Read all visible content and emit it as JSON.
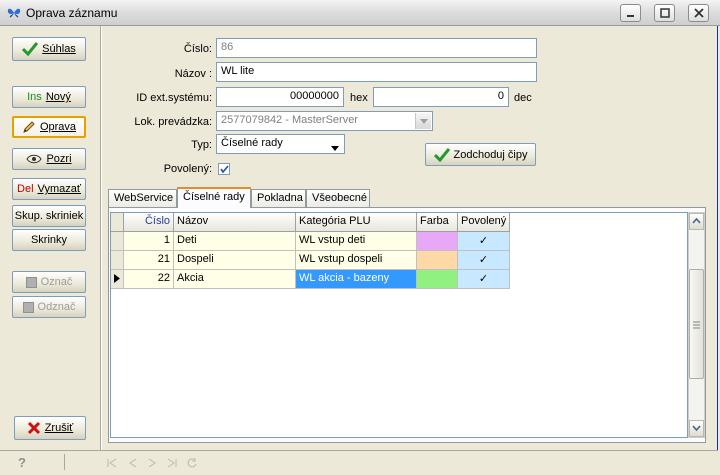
{
  "window": {
    "title": "Oprava záznamu"
  },
  "left_buttons": {
    "suhlas": "Súhlas",
    "novy_prefix": "Ins",
    "novy": "Nový",
    "oprava": "Oprava",
    "pozri": "Pozri",
    "vymazat_prefix": "Del",
    "vymazat": "Vymazať",
    "skup_skriniek": "Skup. skriniek",
    "skrinky": "Skrinky",
    "oznac": "Označ",
    "odznac": "Odznač",
    "zrusit": "Zrušiť"
  },
  "form": {
    "cislo_label": "Číslo:",
    "cislo_value": "86",
    "nazov_label": "Názov :",
    "nazov_value": "WL lite",
    "id_label": "ID ext.systému:",
    "id_hex_value": "00000000",
    "hex_label": "hex",
    "id_dec_value": "0",
    "dec_label": "dec",
    "prevadzka_label": "Lok. prevádzka:",
    "prevadzka_value": "2577079842 - MasterServer",
    "typ_label": "Typ:",
    "typ_value": "Číselné rady",
    "povoleny_label": "Povolený:",
    "povoleny_checked": true,
    "zodchoduj_button": "Zodchoduj čipy"
  },
  "tabs": [
    {
      "label": "WebService"
    },
    {
      "label": "Číselné rady"
    },
    {
      "label": "Pokladna"
    },
    {
      "label": "Všeobecné"
    }
  ],
  "active_tab": "Číselné rady",
  "grid": {
    "columns": [
      "Číslo",
      "Názov",
      "Kategória PLU",
      "Farba",
      "Povolený"
    ],
    "rows": [
      {
        "cislo": "1",
        "nazov": "Deti",
        "kategoria": "WL vstup deti",
        "farba": "#e8a8f8",
        "povoleny": "✓"
      },
      {
        "cislo": "21",
        "nazov": "Dospeli",
        "kategoria": "WL vstup dospeli",
        "farba": "#ffd8a8",
        "povoleny": "✓"
      },
      {
        "cislo": "22",
        "nazov": "Akcia",
        "kategoria": "WL akcia - bazeny",
        "farba": "#90f080",
        "povoleny": "✓"
      }
    ],
    "selected_row": 2
  },
  "colors": {
    "cell_bg": "#ffffe8",
    "povoleny_bg": "#c8e8ff",
    "selection": "#3399ff",
    "accent_tab": "#e68b2c"
  }
}
